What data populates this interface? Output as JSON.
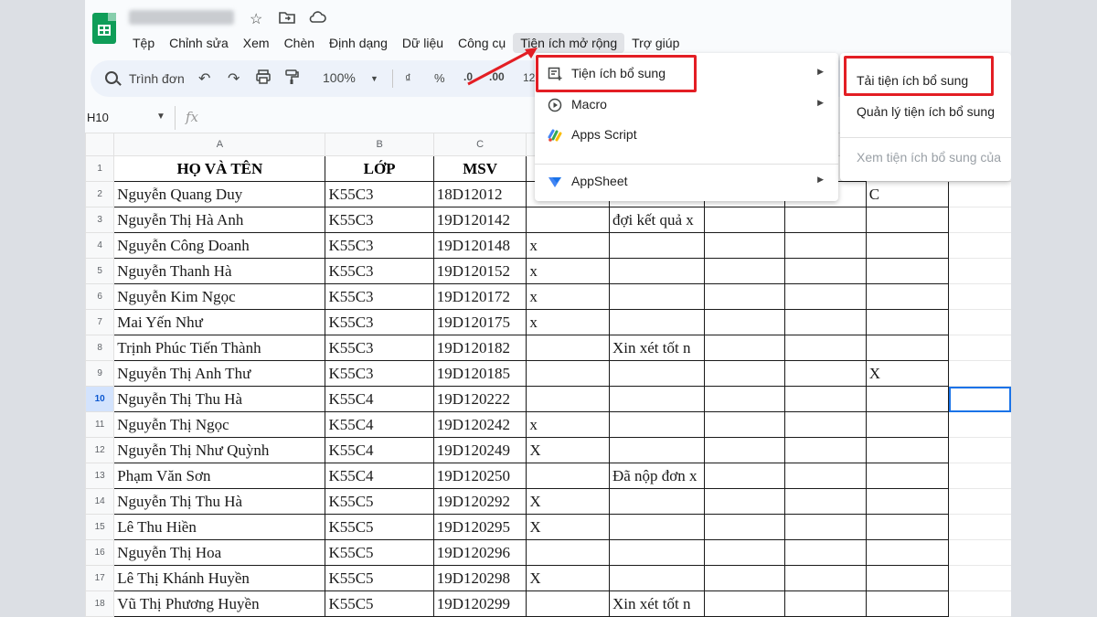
{
  "app": {
    "doc_title": "",
    "menus": [
      "Tệp",
      "Chỉnh sửa",
      "Xem",
      "Chèn",
      "Định dạng",
      "Dữ liệu",
      "Công cụ",
      "Tiện ích mở rộng",
      "Trợ giúp"
    ]
  },
  "toolbar": {
    "search_label": "Trình đơn",
    "zoom": "100%",
    "currency": "₫",
    "percent": "%",
    "dec_less": ".0",
    "dec_more": ".00",
    "number_format": "12"
  },
  "formula_bar": {
    "name_box": "H10",
    "fx": "fx"
  },
  "sheet": {
    "col_headers": [
      "A",
      "B",
      "C",
      "",
      "",
      "",
      "",
      "",
      ""
    ],
    "header_row": [
      "HỌ VÀ TÊN",
      "LỚP",
      "MSV"
    ],
    "rows": [
      {
        "n": "2",
        "name": "Nguyễn Quang Duy",
        "cls": "K55C3",
        "msv": "18D12012",
        "d": "",
        "e": "",
        "f": "",
        "g": "C"
      },
      {
        "n": "3",
        "name": "Nguyễn Thị Hà Anh",
        "cls": "K55C3",
        "msv": "19D120142",
        "d": "",
        "e": "đợi kết quả x",
        "f": "",
        "g": ""
      },
      {
        "n": "4",
        "name": "Nguyễn Công Doanh",
        "cls": "K55C3",
        "msv": "19D120148",
        "d": "x",
        "e": "",
        "f": "",
        "g": ""
      },
      {
        "n": "5",
        "name": "Nguyễn Thanh Hà",
        "cls": "K55C3",
        "msv": "19D120152",
        "d": "x",
        "e": "",
        "f": "",
        "g": ""
      },
      {
        "n": "6",
        "name": "Nguyễn Kim Ngọc",
        "cls": "K55C3",
        "msv": "19D120172",
        "d": "x",
        "e": "",
        "f": "",
        "g": ""
      },
      {
        "n": "7",
        "name": "Mai Yến Như",
        "cls": "K55C3",
        "msv": "19D120175",
        "d": "x",
        "e": "",
        "f": "",
        "g": ""
      },
      {
        "n": "8",
        "name": "Trịnh Phúc Tiến Thành",
        "cls": "K55C3",
        "msv": "19D120182",
        "d": "",
        "e": "Xin xét tốt n",
        "f": "",
        "g": ""
      },
      {
        "n": "9",
        "name": "Nguyễn Thị Anh Thư",
        "cls": "K55C3",
        "msv": "19D120185",
        "d": "",
        "e": "",
        "f": "",
        "g": "X"
      },
      {
        "n": "10",
        "name": "Nguyễn Thị Thu Hà",
        "cls": "K55C4",
        "msv": "19D120222",
        "d": "",
        "e": "",
        "f": "",
        "g": ""
      },
      {
        "n": "11",
        "name": "Nguyễn Thị Ngọc",
        "cls": "K55C4",
        "msv": "19D120242",
        "d": "x",
        "e": "",
        "f": "",
        "g": ""
      },
      {
        "n": "12",
        "name": "Nguyễn Thị Như Quỳnh",
        "cls": "K55C4",
        "msv": "19D120249",
        "d": "X",
        "e": "",
        "f": "",
        "g": ""
      },
      {
        "n": "13",
        "name": "Phạm Văn Sơn",
        "cls": "K55C4",
        "msv": "19D120250",
        "d": "",
        "e": "Đã nộp đơn x",
        "f": "",
        "g": ""
      },
      {
        "n": "14",
        "name": "Nguyễn Thị Thu Hà",
        "cls": "K55C5",
        "msv": "19D120292",
        "d": "X",
        "e": "",
        "f": "",
        "g": ""
      },
      {
        "n": "15",
        "name": "Lê Thu Hiền",
        "cls": "K55C5",
        "msv": "19D120295",
        "d": "X",
        "e": "",
        "f": "",
        "g": ""
      },
      {
        "n": "16",
        "name": "Nguyễn Thị Hoa",
        "cls": "K55C5",
        "msv": "19D120296",
        "d": "",
        "e": "",
        "f": "",
        "g": ""
      },
      {
        "n": "17",
        "name": "Lê Thị Khánh Huyền",
        "cls": "K55C5",
        "msv": "19D120298",
        "d": "X",
        "e": "",
        "f": "",
        "g": ""
      },
      {
        "n": "18",
        "name": "Vũ Thị Phương Huyền",
        "cls": "K55C5",
        "msv": "19D120299",
        "d": "",
        "e": "Xin xét tốt n",
        "f": "",
        "g": ""
      }
    ]
  },
  "extensions_menu": {
    "items": [
      {
        "label": "Tiện ích bổ sung",
        "icon": "addons-icon",
        "has_submenu": true
      },
      {
        "label": "Macro",
        "icon": "play-circle-icon",
        "has_submenu": true
      },
      {
        "label": "Apps Script",
        "icon": "apps-script-icon",
        "has_submenu": false
      },
      {
        "label": "AppSheet",
        "icon": "appsheet-icon",
        "has_submenu": true
      }
    ]
  },
  "addons_submenu": {
    "items": [
      {
        "label": "Tải tiện ích bổ sung",
        "disabled": false
      },
      {
        "label": "Quản lý tiện ích bổ sung",
        "disabled": false
      },
      {
        "label": "Xem tiện ích bổ sung của",
        "disabled": true
      }
    ]
  },
  "colors": {
    "highlight": "#e31e24",
    "sheets_green": "#0f9d58",
    "selection": "#1a73e8"
  }
}
